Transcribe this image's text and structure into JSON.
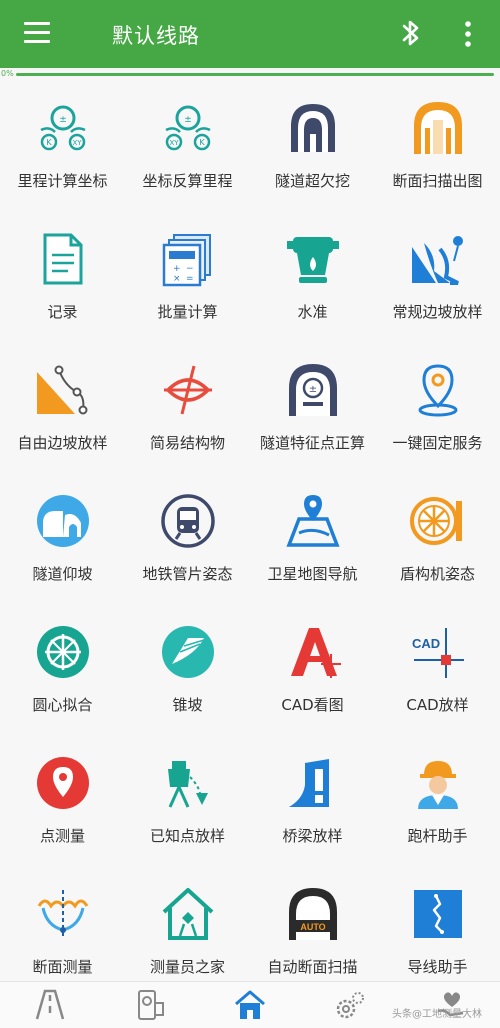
{
  "header": {
    "title": "默认线路",
    "menu_icon": "hamburger-menu-icon",
    "bluetooth_icon": "bluetooth-icon",
    "more_icon": "more-vertical-icon",
    "bar_color": "#45a845"
  },
  "progress": {
    "label": "0%",
    "value": 0
  },
  "tools": [
    {
      "label": "里程计算坐标",
      "icon": "mileage-to-coordinate-icon"
    },
    {
      "label": "坐标反算里程",
      "icon": "coordinate-to-mileage-icon"
    },
    {
      "label": "隧道超欠挖",
      "icon": "tunnel-overbreak-icon"
    },
    {
      "label": "断面扫描出图",
      "icon": "section-scan-icon"
    },
    {
      "label": "记录",
      "icon": "record-document-icon"
    },
    {
      "label": "批量计算",
      "icon": "batch-calculator-icon"
    },
    {
      "label": "水准",
      "icon": "level-instrument-icon"
    },
    {
      "label": "常规边坡放样",
      "icon": "slope-stakeout-icon"
    },
    {
      "label": "自由边坡放样",
      "icon": "free-slope-icon"
    },
    {
      "label": "简易结构物",
      "icon": "simple-structure-icon"
    },
    {
      "label": "隧道特征点正算",
      "icon": "tunnel-feature-point-icon"
    },
    {
      "label": "一键固定服务",
      "icon": "location-pin-icon"
    },
    {
      "label": "隧道仰坡",
      "icon": "tunnel-slope-icon"
    },
    {
      "label": "地铁管片姿态",
      "icon": "metro-train-icon"
    },
    {
      "label": "卫星地图导航",
      "icon": "satellite-map-icon"
    },
    {
      "label": "盾构机姿态",
      "icon": "shield-machine-icon"
    },
    {
      "label": "圆心拟合",
      "icon": "circle-fit-icon"
    },
    {
      "label": "锥坡",
      "icon": "cone-slope-icon"
    },
    {
      "label": "CAD看图",
      "icon": "cad-viewer-icon"
    },
    {
      "label": "CAD放样",
      "icon": "cad-stakeout-icon"
    },
    {
      "label": "点测量",
      "icon": "point-measure-icon"
    },
    {
      "label": "已知点放样",
      "icon": "known-point-stakeout-icon"
    },
    {
      "label": "桥梁放样",
      "icon": "bridge-stakeout-icon"
    },
    {
      "label": "跑杆助手",
      "icon": "worker-helmet-icon"
    },
    {
      "label": "断面测量",
      "icon": "section-measure-icon"
    },
    {
      "label": "测量员之家",
      "icon": "surveyor-home-icon"
    },
    {
      "label": "自动断面扫描",
      "icon": "auto-section-scan-icon"
    },
    {
      "label": "导线助手",
      "icon": "traverse-map-icon"
    }
  ],
  "bottom_nav": [
    {
      "icon": "road-icon"
    },
    {
      "icon": "phone-instrument-icon"
    },
    {
      "icon": "home-icon",
      "active": true
    },
    {
      "icon": "settings-gear-icon"
    },
    {
      "icon": "heart-hand-icon"
    }
  ],
  "watermark": "头条@工地测量大林"
}
